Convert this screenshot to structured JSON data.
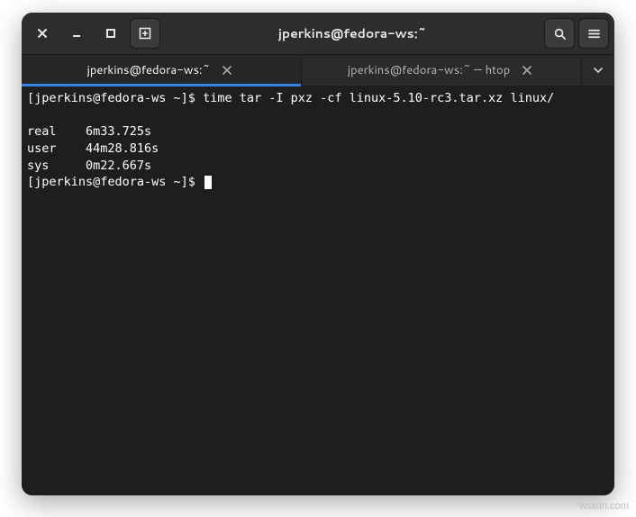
{
  "titlebar": {
    "title": "jperkins@fedora-ws:~"
  },
  "tabs": [
    {
      "label": "jperkins@fedora-ws:~",
      "active": true
    },
    {
      "label": "jperkins@fedora-ws:~ — htop",
      "active": false
    }
  ],
  "terminal": {
    "prompt1": "[jperkins@fedora-ws ~]$ ",
    "command": "time tar -I pxz -cf linux-5.10-rc3.tar.xz linux/",
    "blank": "",
    "time_rows": [
      {
        "label": "real",
        "value": "6m33.725s"
      },
      {
        "label": "user",
        "value": "44m28.816s"
      },
      {
        "label": "sys",
        "value": "0m22.667s"
      }
    ],
    "prompt2": "[jperkins@fedora-ws ~]$ "
  },
  "watermark": "wsxdn.com"
}
